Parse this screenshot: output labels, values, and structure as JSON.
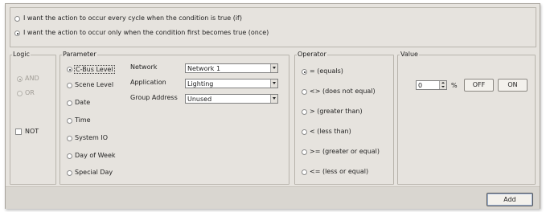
{
  "trigger": {
    "every_cycle_label": "I want the action to occur every cycle when the condition is true (if)",
    "first_true_label": "I want the action to occur only when the condition first becomes true (once)",
    "selected": "first_true"
  },
  "logic": {
    "title": "Logic",
    "and_label": "AND",
    "or_label": "OR",
    "not_label": "NOT"
  },
  "parameter": {
    "title": "Parameter",
    "options": [
      "C-Bus Level",
      "Scene Level",
      "Date",
      "Time",
      "System IO",
      "Day of Week",
      "Special Day"
    ],
    "selected": "C-Bus Level",
    "network_label": "Network",
    "network_value": "Network 1",
    "application_label": "Application",
    "application_value": "Lighting",
    "group_address_label": "Group Address",
    "group_address_value": "Unused"
  },
  "operator": {
    "title": "Operator",
    "options": [
      "= (equals)",
      "<> (does not equal)",
      "> (greater than)",
      "< (less than)",
      ">= (greater or equal)",
      "<= (less or equal)"
    ],
    "selected": "= (equals)"
  },
  "value": {
    "title": "Value",
    "level": "0",
    "unit": "%",
    "off_label": "OFF",
    "on_label": "ON"
  },
  "footer": {
    "add_label": "Add"
  }
}
